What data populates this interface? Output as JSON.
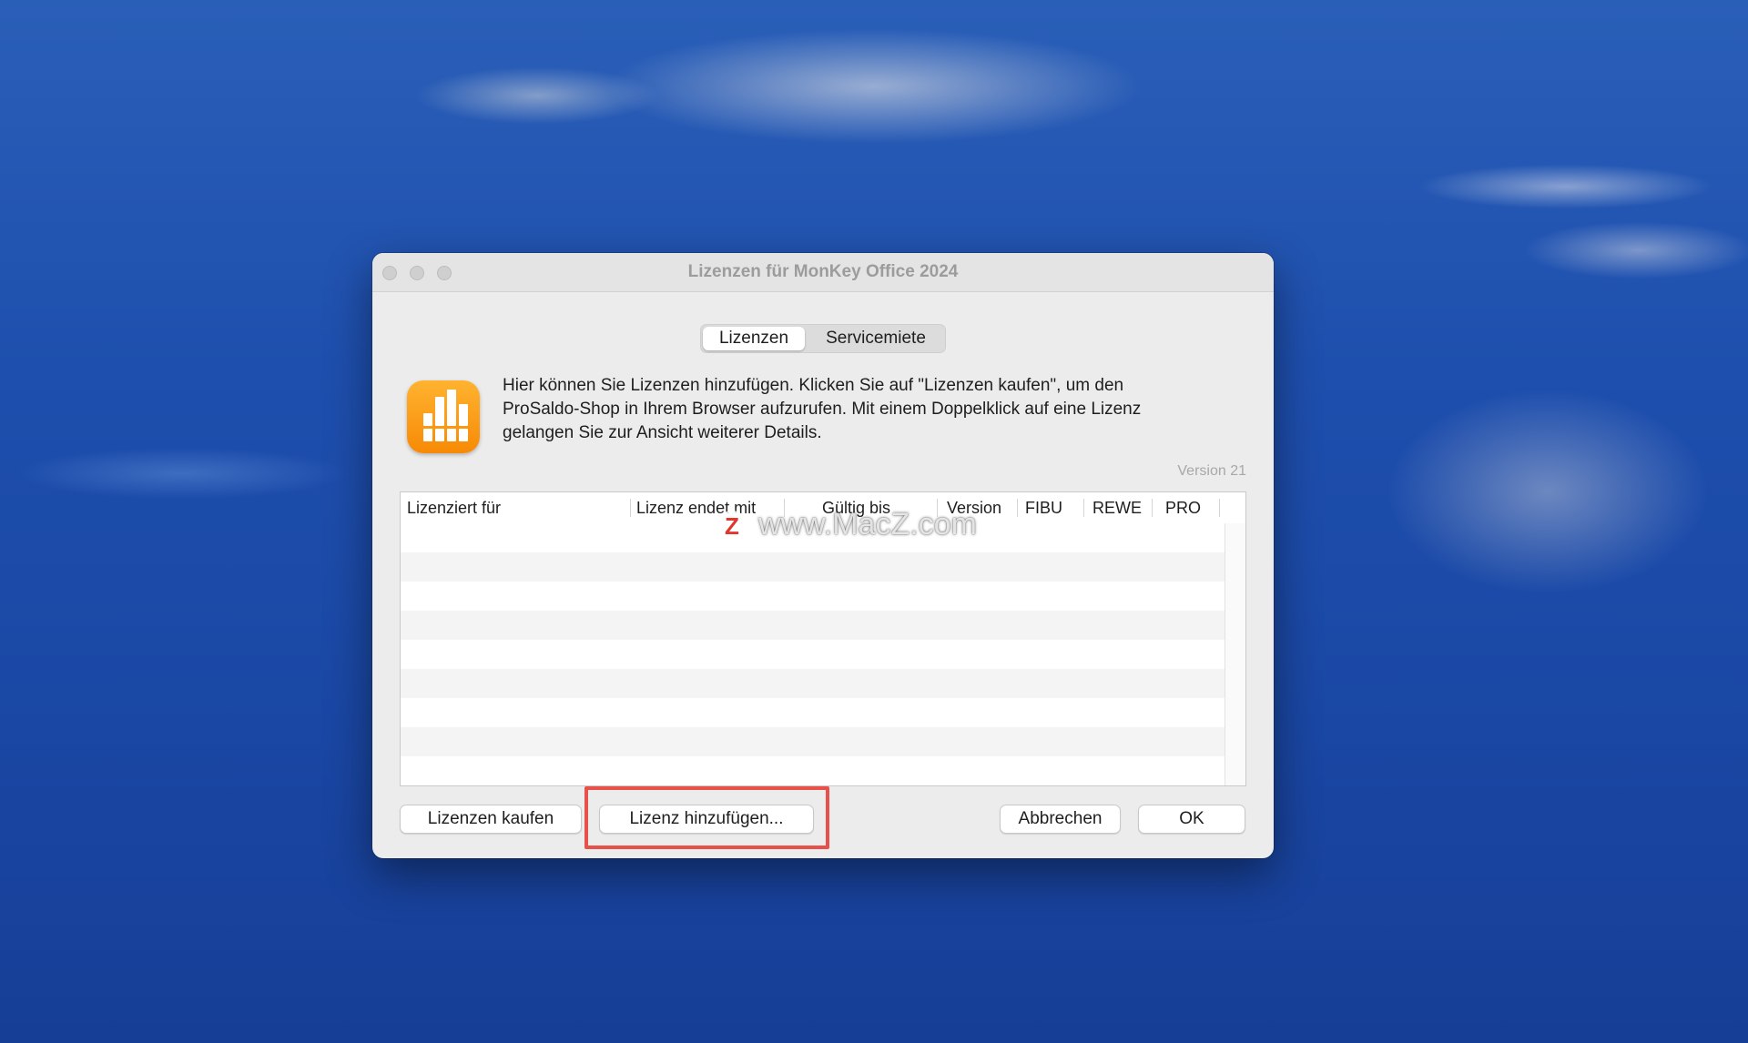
{
  "window": {
    "title": "Lizenzen für MonKey Office 2024"
  },
  "tabs": [
    {
      "label": "Lizenzen",
      "active": true
    },
    {
      "label": "Servicemiete",
      "active": false
    }
  ],
  "app": {
    "icon": "bar-chart-app-icon",
    "icon_color": "#F7950F"
  },
  "description": {
    "line1": "Hier können Sie Lizenzen hinzufügen. Klicken Sie auf \"Lizenzen kaufen\", um den",
    "line2": "ProSaldo-Shop in Ihrem Browser aufzurufen. Mit einem Doppelklick auf eine Lizenz",
    "line3": "gelangen Sie zur Ansicht weiterer Details."
  },
  "version_label": "Version 21",
  "table": {
    "columns": [
      "Lizenziert für",
      "Lizenz endet mit",
      "Gültig bis",
      "Version",
      "FIBU",
      "REWE",
      "PRO"
    ],
    "rows": []
  },
  "watermark": {
    "logo_letter": "Z",
    "text": "www.MacZ.com"
  },
  "buttons": {
    "buy": "Lizenzen kaufen",
    "add": "Lizenz hinzufügen...",
    "cancel": "Abbrechen",
    "ok": "OK"
  },
  "colors": {
    "highlight": "#E8504A",
    "desktop_blue": "#1E4FAE"
  }
}
